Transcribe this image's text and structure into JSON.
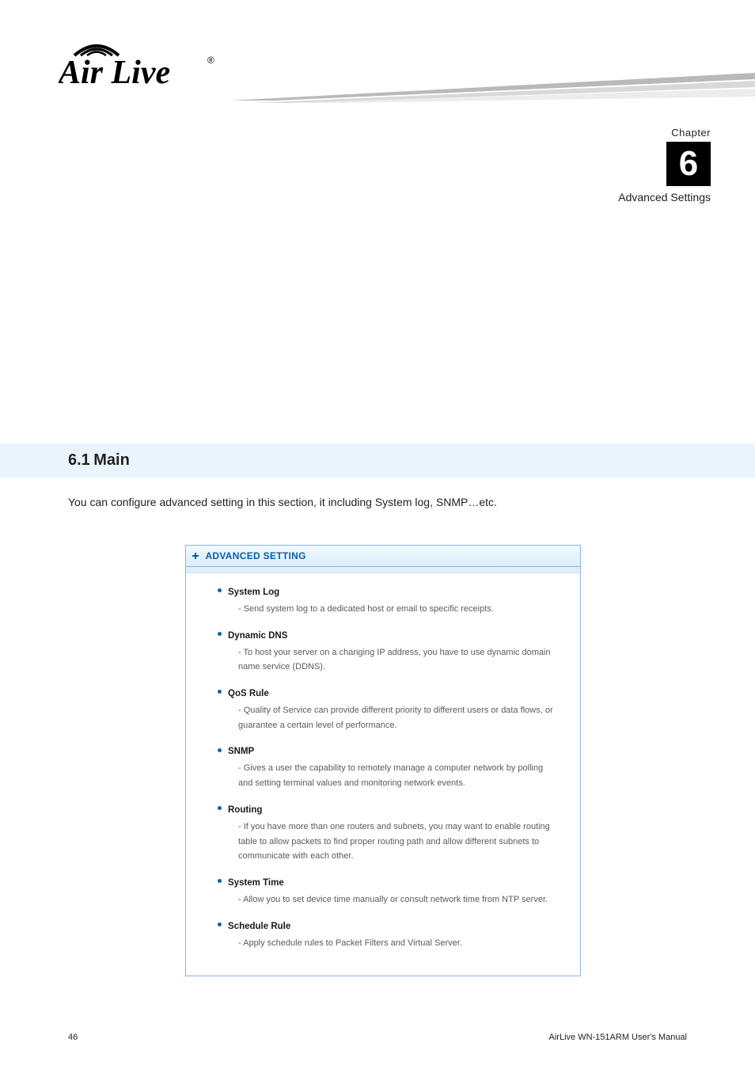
{
  "logo": {
    "alt": "Air Live"
  },
  "chapter": {
    "marker_word": "Chapter",
    "number": "6",
    "title": "Advanced Settings"
  },
  "section": {
    "number": "6.1",
    "name": "Main",
    "intro": "You can configure advanced setting in this section, it including System log, SNMP…etc."
  },
  "panel": {
    "title": "ADVANCED SETTING",
    "items": [
      {
        "title": "System Log",
        "desc": "- Send system log to a dedicated host or email to specific receipts."
      },
      {
        "title": "Dynamic DNS",
        "desc": "- To host your server on a changing IP address, you have to use dynamic domain name service (DDNS)."
      },
      {
        "title": "QoS Rule",
        "desc": "- Quality of Service can provide different priority to different users or data flows, or guarantee a certain level of performance."
      },
      {
        "title": "SNMP",
        "desc": "- Gives a user the capability to remotely manage a computer network by polling and setting terminal values and monitoring network events."
      },
      {
        "title": "Routing",
        "desc": "- If you have more than one routers and subnets, you may want to enable routing table to allow packets to find proper routing path and allow different subnets to communicate with each other."
      },
      {
        "title": "System Time",
        "desc": "- Allow you to set device time manually or consult network time from NTP server."
      },
      {
        "title": "Schedule Rule",
        "desc": "- Apply schedule rules to Packet Filters and Virtual Server."
      }
    ]
  },
  "footer": {
    "page_number": "46",
    "doc_title": "AirLive WN-151ARM User's Manual"
  }
}
